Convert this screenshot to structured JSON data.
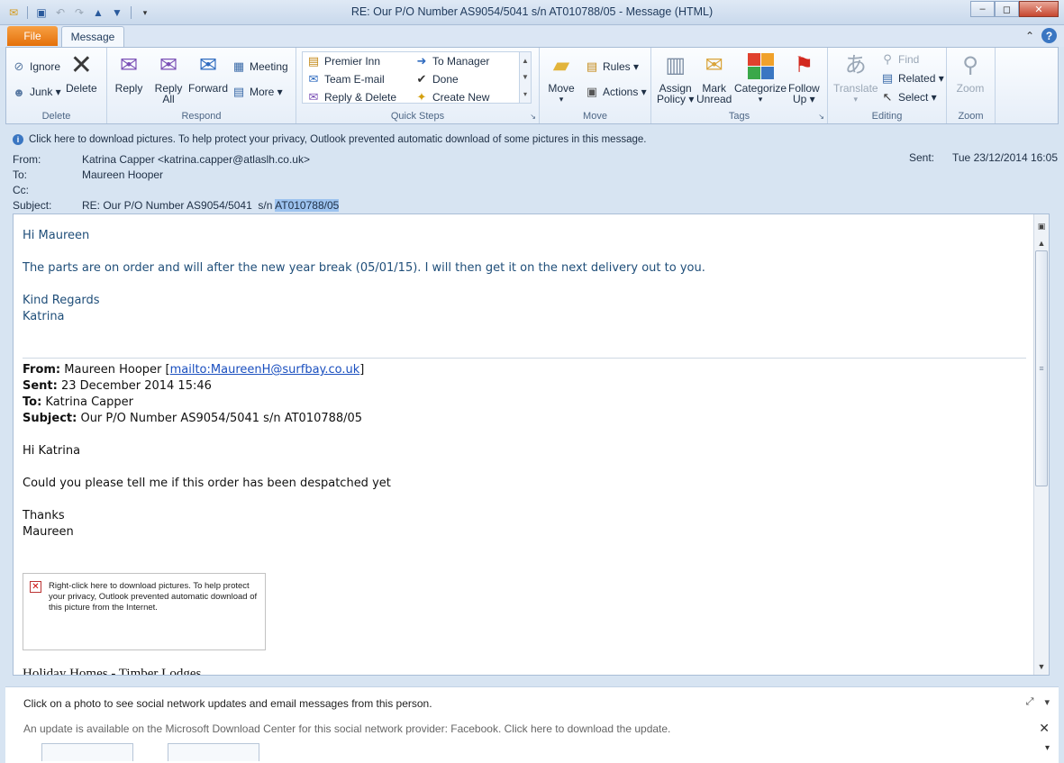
{
  "window": {
    "title": "RE: Our P/O Number AS9054/5041  s/n AT010788/05  -  Message (HTML)",
    "minimize": "–",
    "maximize": "◻",
    "close": "✕"
  },
  "tabs": {
    "file": "File",
    "message": "Message",
    "collapse": "⌃",
    "help": "?"
  },
  "ribbon": {
    "delete": {
      "label": "Delete",
      "ignore": "Ignore",
      "junk": "Junk ▾",
      "delete": "Delete"
    },
    "respond": {
      "label": "Respond",
      "reply": "Reply",
      "reply_all_1": "Reply",
      "reply_all_2": "All",
      "forward": "Forward",
      "meeting": "Meeting",
      "more": "More ▾"
    },
    "quick_steps": {
      "label": "Quick Steps",
      "premier_inn": "Premier Inn",
      "team_email": "Team E-mail",
      "reply_delete": "Reply & Delete",
      "to_manager": "To Manager",
      "done": "Done",
      "create_new": "Create New"
    },
    "move": {
      "label": "Move",
      "move_1": "Move",
      "move_2": "▾",
      "rules": "Rules ▾",
      "actions": "Actions ▾"
    },
    "tags": {
      "label": "Tags",
      "assign_1": "Assign",
      "assign_2": "Policy ▾",
      "mark_1": "Mark",
      "mark_2": "Unread",
      "categorize_1": "Categorize",
      "categorize_2": "▾",
      "follow_1": "Follow",
      "follow_2": "Up ▾"
    },
    "editing": {
      "label": "Editing",
      "translate_1": "Translate",
      "translate_2": "▾",
      "find": "Find",
      "related": "Related ▾",
      "select": "Select ▾"
    },
    "zoom": {
      "label": "Zoom",
      "zoom": "Zoom"
    }
  },
  "infobar": "Click here to download pictures. To help protect your privacy, Outlook prevented automatic download of some pictures in this message.",
  "headers": {
    "from_label": "From:",
    "from_value": "Katrina Capper <katrina.capper@atlaslh.co.uk>",
    "to_label": "To:",
    "to_value": "Maureen Hooper",
    "cc_label": "Cc:",
    "subject_label": "Subject:",
    "subject_value": "RE: Our P/O Number AS9054/5041  s/n ",
    "subject_highlight": "AT010788/05",
    "sent_label": "Sent:",
    "sent_value": "Tue 23/12/2014 16:05"
  },
  "reply": {
    "greeting": "Hi Maureen",
    "body": "The parts are on order and will after the new year break (05/01/15).  I will then get it on the next delivery out to you.",
    "regards": "Kind Regards",
    "name": "Katrina"
  },
  "original": {
    "from_label": "From:",
    "from_value": " Maureen Hooper [",
    "from_link": "mailto:MaureenH@surfbay.co.uk",
    "from_end": "]",
    "sent_label": "Sent:",
    "sent_value": " 23 December 2014 15:46",
    "to_label": "To:",
    "to_value": " Katrina Capper",
    "subject_label": "Subject:",
    "subject_value": " Our P/O Number AS9054/5041 s/n AT010788/05",
    "greeting": "Hi Katrina",
    "body": "Could you please tell me if this order has been despatched yet",
    "thanks": "Thanks",
    "name": "Maureen",
    "img_placeholder": "Right-click here to download pictures.  To help protect your privacy, Outlook prevented automatic download of this picture from the Internet.",
    "cutoff": "Holiday Homes - Timber Lodges"
  },
  "people_pane": {
    "message": "Click on a photo to see social network updates and email messages from this person.",
    "update": "An update is available on the Microsoft Download Center for this social network provider: Facebook. Click here to download the update."
  }
}
